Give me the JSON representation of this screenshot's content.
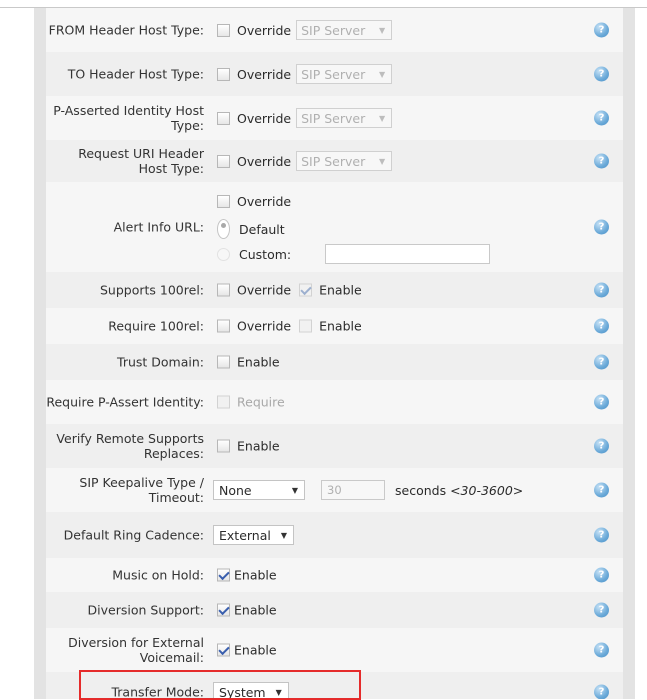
{
  "help_glyph": "?",
  "override_label": "Override",
  "enable_label": "Enable",
  "rows": {
    "from_header": {
      "label": "FROM Header Host Type:",
      "select": "SIP Server"
    },
    "to_header": {
      "label": "TO Header Host Type:",
      "select": "SIP Server"
    },
    "p_asserted": {
      "label": "P-Asserted Identity Host Type:",
      "select": "SIP Server"
    },
    "request_uri": {
      "label": "Request URI Header Host Type:",
      "select": "SIP Server"
    },
    "alert_info": {
      "label": "Alert Info URL:",
      "default_label": "Default",
      "custom_label": "Custom:",
      "custom_value": ""
    },
    "supports_100rel": {
      "label": "Supports 100rel:"
    },
    "require_100rel": {
      "label": "Require 100rel:"
    },
    "trust_domain": {
      "label": "Trust Domain:"
    },
    "require_passert": {
      "label": "Require P-Assert Identity:",
      "checkbox_label": "Require"
    },
    "verify_remote": {
      "label": "Verify Remote Supports Replaces:"
    },
    "keepalive": {
      "label": "SIP Keepalive Type / Timeout:",
      "select": "None",
      "timeout_value": "30",
      "unit": "seconds",
      "range": "<30-3600>"
    },
    "ring_cadence": {
      "label": "Default Ring Cadence:",
      "select": "External"
    },
    "music_hold": {
      "label": "Music on Hold:"
    },
    "diversion_support": {
      "label": "Diversion Support:"
    },
    "diversion_vm": {
      "label": "Diversion for External Voicemail:"
    },
    "transfer_mode": {
      "label": "Transfer Mode:",
      "select": "System"
    }
  },
  "colors": {
    "highlight": "#e52b2b",
    "help": "#6aa9d8"
  }
}
